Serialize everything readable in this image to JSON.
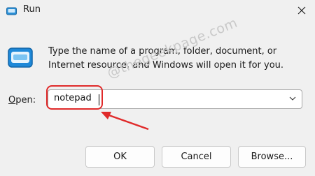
{
  "window": {
    "title": "Run",
    "close_icon": "close-icon"
  },
  "dialog": {
    "icon": "run-dialog-icon",
    "description_line1": "Type the name of a program, folder, document, or",
    "description_line2": "Internet resource, and Windows will open it for you.",
    "open_label": "pen:",
    "open_label_accel": "O",
    "open_value": "notepad"
  },
  "watermark": "@thegeekpage.com",
  "annotation": {
    "color": "#e02a2a"
  },
  "buttons": {
    "ok": "OK",
    "cancel": "Cancel",
    "browse": "Browse..."
  }
}
